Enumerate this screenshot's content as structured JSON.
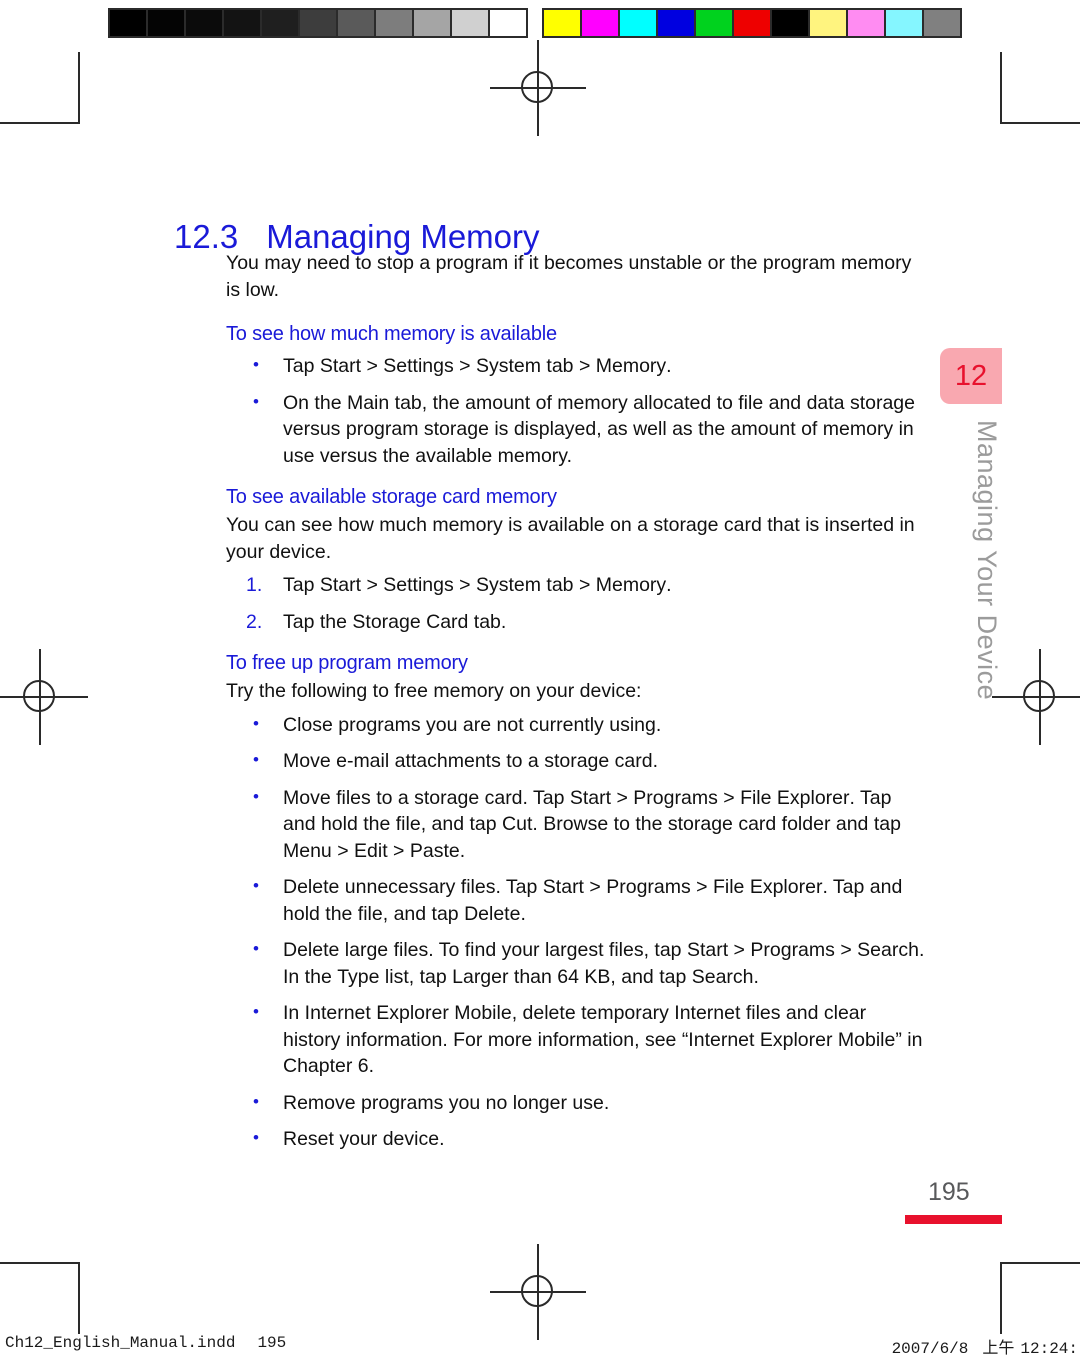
{
  "calibration": {
    "gray_wedge": [
      "#000000",
      "#040404",
      "#0b0b0b",
      "#131313",
      "#1f1f1f",
      "#3d3d3d",
      "#5a5a5a",
      "#7d7d7d",
      "#a5a5a5",
      "#d0d0d0",
      "#ffffff"
    ],
    "color_wedge": [
      "#ffff00",
      "#ff00ff",
      "#00ffff",
      "#0000e0",
      "#00d21e",
      "#ee0000",
      "#000000",
      "#fff47f",
      "#ff8cf2",
      "#85f6ff",
      "#808080"
    ]
  },
  "page": {
    "section_number": "12.3",
    "section_title": "Managing Memory",
    "intro": "You may need to stop a program if it becomes unstable or the program memory is low.",
    "page_number": "195"
  },
  "sections": {
    "availability": {
      "heading": "To see how much memory is available",
      "bullets": [
        "Tap Start > Settings > System tab > Memory.",
        "On the Main tab, the amount of memory allocated to file and data storage versus program storage is displayed, as well as the amount of memory in use versus the available memory."
      ]
    },
    "storage_card": {
      "heading": "To see available storage card memory",
      "intro": "You can see how much memory is available on a storage card that is inserted in your device.",
      "steps": [
        "Tap Start > Settings > System tab > Memory.",
        "Tap the Storage Card tab."
      ]
    },
    "free_memory": {
      "heading": "To free up program memory",
      "intro": "Try the following to free memory on your device:",
      "bullets": [
        "Close programs you are not currently using.",
        "Move e-mail attachments to a storage card.",
        "Move files to a storage card. Tap Start > Programs > File Explorer. Tap and hold the file, and tap Cut. Browse to the storage card folder and tap Menu > Edit > Paste.",
        "Delete unnecessary files. Tap Start > Programs > File Explorer. Tap and hold the file, and tap Delete.",
        "Delete large files. To find your largest files, tap Start > Programs > Search. In the Type list, tap Larger than 64 KB, and tap Search.",
        "In Internet Explorer Mobile, delete temporary Internet files and clear history information. For more information, see “Internet Explorer Mobile” in Chapter 6.",
        "Remove programs you no longer use.",
        "Reset your device."
      ]
    }
  },
  "chapter_tab": {
    "number": "12",
    "running_head": "Managing Your Device"
  },
  "footer": {
    "filename": "Ch12_English_Manual.indd",
    "folio": "195",
    "date": "2007/6/8",
    "ampm": "上午",
    "time": "12:24:"
  },
  "colors": {
    "heading_blue": "#1a1ad8",
    "tab_pink": "#f9a8b0",
    "tab_red": "#e8112d",
    "folio_gray": "#58595b",
    "running_head_gray": "#9b9b9b"
  }
}
